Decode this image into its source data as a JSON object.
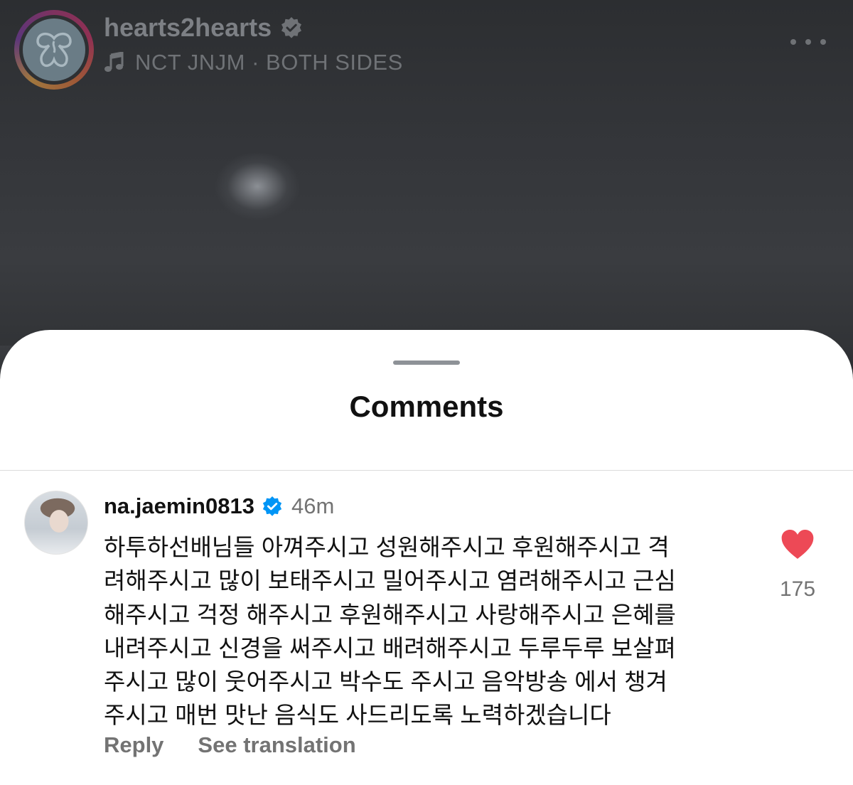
{
  "post": {
    "username": "hearts2hearts",
    "music": "NCT JNJM · BOTH SIDES"
  },
  "sheet": {
    "title": "Comments"
  },
  "comment": {
    "username": "na.jaemin0813",
    "time": "46m",
    "lines": [
      "하투하선배님들 아껴주시고 성원해주시고 후원해주시고 격",
      "려해주시고 많이 보태주시고 밀어주시고 염려해주시고 근심",
      "해주시고 걱정 해주시고 후원해주시고 사랑해주시고 은혜를",
      "내려주시고 신경을 써주시고 배려해주시고 두루두루 보살펴",
      "주시고 많이 웃어주시고 박수도 주시고 음악방송 에서 챙겨",
      "주시고 매번 맛난 음식도 사드리도록 노력하겠습니다"
    ],
    "like_count": "175",
    "reply_label": "Reply",
    "translation_label": "See translation"
  },
  "icons": {
    "verified_gray": "verified-badge-icon",
    "verified_blue": "verified-badge-icon",
    "music": "music-note-icon",
    "more": "more-options-icon",
    "like": "heart-filled-icon"
  },
  "colors": {
    "like": "#ed4956",
    "verified": "#0095f6",
    "secondary_text": "#737373"
  }
}
